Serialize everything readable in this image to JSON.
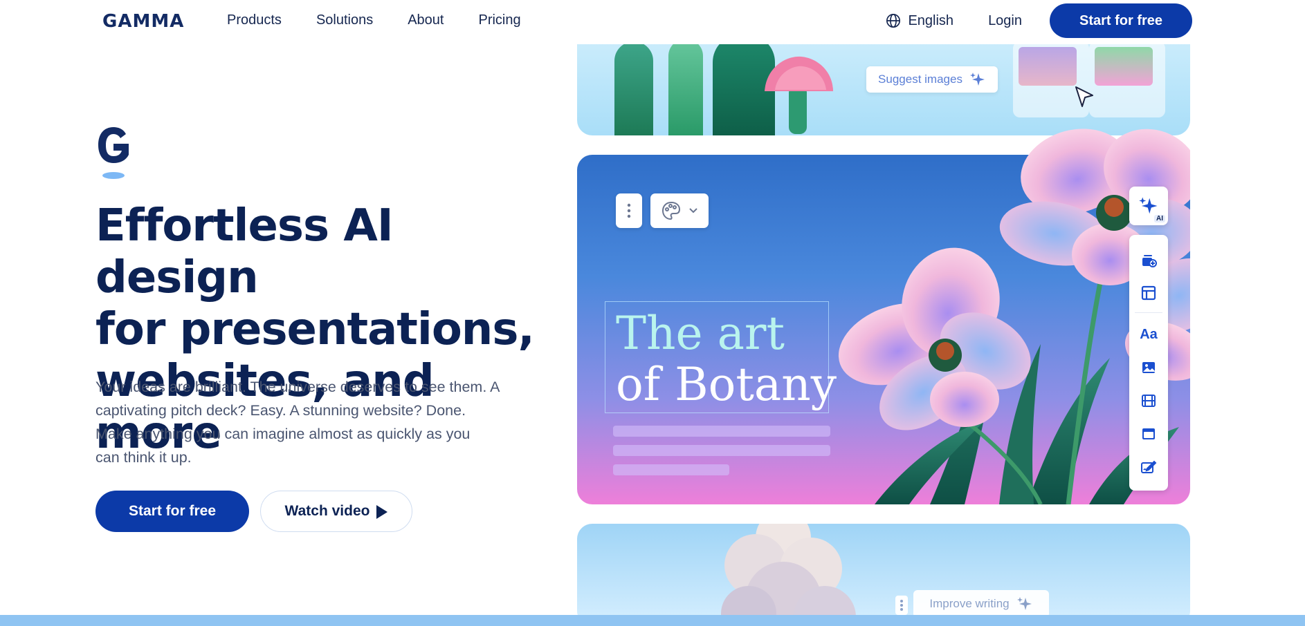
{
  "nav": {
    "logo": "GAMMA",
    "links": [
      "Products",
      "Solutions",
      "About",
      "Pricing"
    ],
    "language": "English",
    "login": "Login",
    "cta": "Start for free"
  },
  "hero": {
    "title_lines": [
      "Effortless AI design",
      "for presentations,",
      "websites, and more"
    ],
    "subtitle_lines": [
      "Your ideas are brilliant. The universe deserves to see them. A",
      "captivating pitch deck? Easy. A stunning website? Done.",
      "Make anything you can imagine almost as quickly as you",
      "can think it up."
    ],
    "primary_cta": "Start for free",
    "secondary_cta": "Watch video"
  },
  "cards": {
    "top": {
      "suggest_label": "Suggest images"
    },
    "main": {
      "title_line1": "The art",
      "title_line2": "of Botany",
      "ai_tag": "AI",
      "text_tool_label": "Aa"
    },
    "bottom": {
      "improve_label": "Improve writing"
    }
  },
  "colors": {
    "brand": "#0c3aa8",
    "heading": "#0c2254",
    "accent_teal": "#b9f4ee",
    "toolbar_icon": "#1a4fd0"
  },
  "icons": [
    "globe-icon",
    "play-icon",
    "sparkle-icon",
    "cursor-arrow-icon",
    "more-vertical-icon",
    "palette-icon",
    "chevron-down-icon",
    "add-card-icon",
    "layout-icon",
    "text-icon",
    "image-icon",
    "video-icon",
    "embed-icon",
    "edit-icon"
  ]
}
